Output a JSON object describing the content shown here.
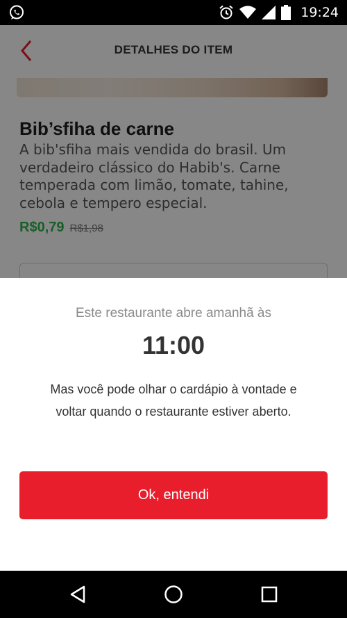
{
  "status_bar": {
    "time": "19:24",
    "icons": [
      "whatsapp-icon",
      "alarm-icon",
      "wifi-icon",
      "signal-icon",
      "battery-icon"
    ]
  },
  "header": {
    "title": "DETALHES DO ITEM",
    "back_icon": "chevron-left-icon"
  },
  "item": {
    "name": "Bib’sfiha de carne",
    "description": "A bib'sfiha mais vendida do brasil. Um verdadeiro clássico do Habib's. Carne temperada com limão, tomate, tahine, cebola e tempero especial.",
    "price": "R$0,79",
    "old_price": "R$1,98"
  },
  "modal": {
    "subtitle": "Este restaurante abre amanhã às",
    "time": "11:00",
    "message": "Mas você pode olhar o cardápio à vontade e voltar quando o restaurante estiver aberto.",
    "button_label": "Ok, entendi"
  },
  "colors": {
    "accent_red": "#e81e2d",
    "price_green": "#2db34a"
  },
  "nav_bar": {
    "icons": [
      "back-triangle-icon",
      "home-circle-icon",
      "recents-square-icon"
    ]
  }
}
